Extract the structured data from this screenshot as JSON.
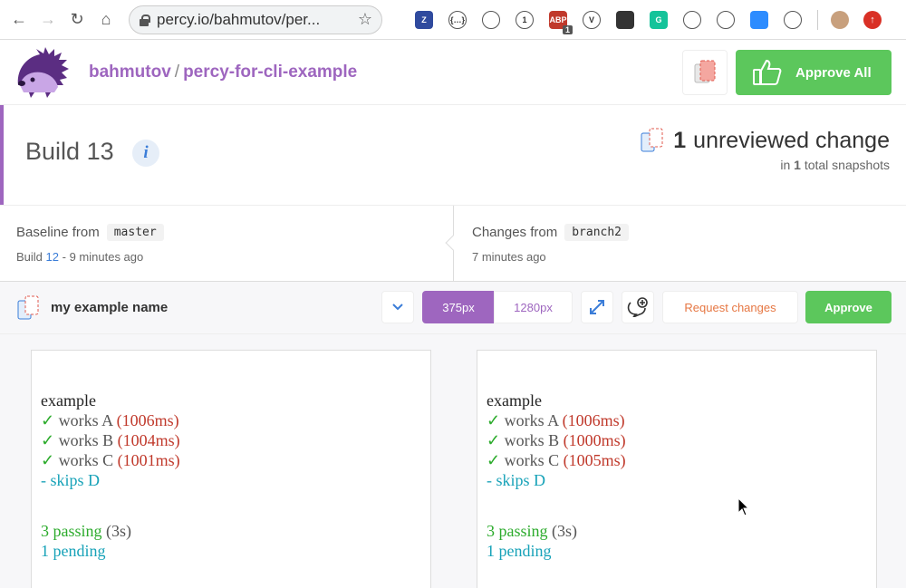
{
  "browser": {
    "url": "percy.io/bahmutov/per...",
    "extensions": [
      {
        "name": "zotero-icon",
        "label": "Z",
        "color": "#2f4a9e"
      },
      {
        "name": "json-viewer-icon",
        "label": "{…}",
        "color": "#ffffff"
      },
      {
        "name": "page-icon",
        "label": "",
        "color": "#ffffff"
      },
      {
        "name": "onepassword-icon",
        "label": "1",
        "color": "#ffffff"
      },
      {
        "name": "adblock-icon",
        "label": "ABP",
        "color": "#c0392b",
        "badge": "1"
      },
      {
        "name": "vue-devtools-icon",
        "label": "V",
        "color": "#ffffff"
      },
      {
        "name": "ghostery-icon",
        "label": "",
        "color": "#333333"
      },
      {
        "name": "grammarly-icon",
        "label": "G",
        "color": "#15c39a"
      },
      {
        "name": "feather-icon",
        "label": "",
        "color": "#ffffff"
      },
      {
        "name": "fox-icon",
        "label": "",
        "color": "#ffffff"
      },
      {
        "name": "zoom-icon",
        "label": "",
        "color": "#2d8cff"
      },
      {
        "name": "camera-icon",
        "label": "",
        "color": "#ffffff"
      }
    ]
  },
  "header": {
    "org": "bahmutov",
    "separator": "/",
    "project": "percy-for-cli-example",
    "approve_all_label": "Approve All"
  },
  "build": {
    "label": "Build",
    "number": "13",
    "info_glyph": "i",
    "unreviewed_count": "1",
    "unreviewed_text": "unreviewed change",
    "total_prefix": "in",
    "total_count": "1",
    "total_suffix": "total snapshots"
  },
  "baseline": {
    "label": "Baseline from",
    "branch": "master",
    "build_prefix": "Build",
    "build_number": "12",
    "time": "- 9 minutes ago"
  },
  "changes": {
    "label": "Changes from",
    "branch": "branch2",
    "time": "7 minutes ago"
  },
  "snapshot": {
    "name": "my example name",
    "width_375": "375px",
    "width_1280": "1280px",
    "request_changes": "Request changes",
    "approve": "Approve"
  },
  "panels": {
    "left": {
      "heading": "example",
      "tests": [
        {
          "label": "works A",
          "time": "(1006ms)"
        },
        {
          "label": "works B",
          "time": "(1004ms)"
        },
        {
          "label": "works C",
          "time": "(1001ms)"
        }
      ],
      "skip": "- skips D",
      "passing": "3 passing",
      "duration": "(3s)",
      "pending": "1 pending"
    },
    "right": {
      "heading": "example",
      "tests": [
        {
          "label": "works A",
          "time": "(1006ms)"
        },
        {
          "label": "works B",
          "time": "(1000ms)"
        },
        {
          "label": "works C",
          "time": "(1005ms)"
        }
      ],
      "skip": "- skips D",
      "passing": "3 passing",
      "duration": "(3s)",
      "pending": "1 pending"
    }
  },
  "colors": {
    "brand_purple": "#9e66bf",
    "approve_green": "#5cc75c",
    "request_orange": "#e67743",
    "link_blue": "#3b7dd8"
  }
}
